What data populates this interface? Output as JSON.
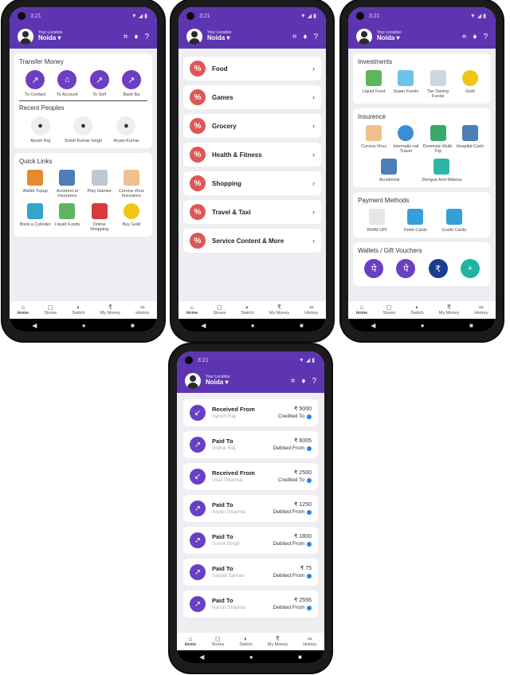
{
  "status": {
    "time": "3:21",
    "icons": "▼◢▮"
  },
  "header": {
    "location_label": "Your Location",
    "city": "Noida",
    "qr_icon": "qr-scan-icon",
    "bell_icon": "bell-icon",
    "help_icon": "help-icon"
  },
  "home": {
    "transfer_title": "Transfer Money",
    "transfer": [
      "To Contact",
      "To Account",
      "To Self",
      "Bank Ba"
    ],
    "recent_title": "Recent Peoples",
    "recent": [
      "Ayush Raj",
      "Sumit Kumar Singh",
      "Aryan Kumar"
    ],
    "quick_title": "Quick Links",
    "quick": [
      "Wallet Topup",
      "Accident al Insurance",
      "Play Games",
      "Corona Virus Insurance",
      "Book a Cylinder",
      "Liquid Funds",
      "Online Shopping",
      "Buy Gold"
    ]
  },
  "stores": {
    "items": [
      "Food",
      "Games",
      "Grocery",
      "Health & Fitness",
      "Shopping",
      "Travel & Taxi",
      "Service Content & More"
    ]
  },
  "switch": {
    "investments_title": "Investments",
    "investments": [
      "Liquid Fund",
      "Super Funds",
      "Tax Saving Funds",
      "Gold"
    ],
    "insurance_title": "Insurence",
    "insurance": [
      "Corona Virus",
      "Internatio nal Travel",
      "Domestic Multi-Trip",
      "Hospital Cash",
      "Accidental",
      "Dengue And Maleria"
    ],
    "payment_title": "Payment Methods",
    "payment": [
      "BHIM UPI",
      "Debit Cards",
      "Credit Cards"
    ],
    "wallets_title": "Wallets / Gift Vouchers"
  },
  "history": {
    "txns": [
      {
        "title": "Received From",
        "name": "Ayush Raj",
        "amount": "₹ 5000",
        "status": "Credited To"
      },
      {
        "title": "Paid To",
        "name": "Vishal Raj",
        "amount": "₹ 6005",
        "status": "Debited From"
      },
      {
        "title": "Received From",
        "name": "Virat Sharma",
        "amount": "₹ 2500",
        "status": "Credited To"
      },
      {
        "title": "Paid To",
        "name": "Aryan Sharma",
        "amount": "₹ 1250",
        "status": "Debited From"
      },
      {
        "title": "Paid To",
        "name": "Sumit Singh",
        "amount": "₹ 1800",
        "status": "Debited From"
      },
      {
        "title": "Paid To",
        "name": "Sayad Saman",
        "amount": "₹ 75",
        "status": "Debited From"
      },
      {
        "title": "Paid To",
        "name": "Harsh Sharma",
        "amount": "₹ 2556",
        "status": "Debited From"
      }
    ]
  },
  "nav": [
    "Home",
    "Stores",
    "Switch",
    "My Money",
    "History"
  ],
  "colors": {
    "primary": "#5e35b1",
    "accent": "#e25555",
    "info": "#1e88e5"
  }
}
